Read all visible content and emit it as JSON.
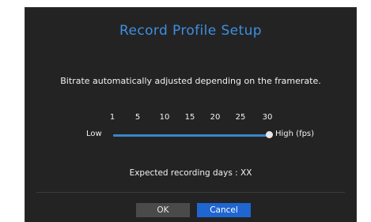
{
  "dialog": {
    "title": "Record Profile Setup",
    "message": "Bitrate automatically adjusted depending on the framerate.",
    "slider": {
      "ticks": [
        "1",
        "5",
        "10",
        "15",
        "20",
        "25",
        "30"
      ],
      "low_label": "Low",
      "high_label": "High (fps)",
      "selected_value": 30,
      "min": 1,
      "max": 30
    },
    "expected_label": "Expected recording days : XX",
    "buttons": {
      "ok_label": "OK",
      "cancel_label": "Cancel"
    }
  },
  "colors": {
    "title": "#3e8fe0",
    "track": "#3a86c8",
    "cancel_active": "#1f66d1",
    "dialog_bg": "#232324"
  }
}
